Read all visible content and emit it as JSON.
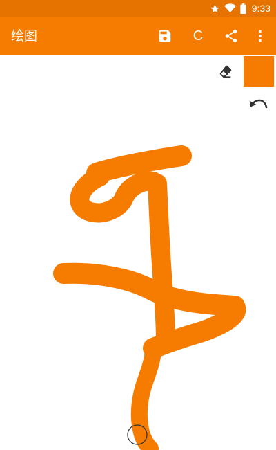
{
  "status_bar": {
    "time": "9:33",
    "icons": [
      "star-icon",
      "wifi-icon",
      "battery-icon"
    ]
  },
  "app_bar": {
    "title": "绘图",
    "clear_label": "C",
    "actions": [
      "save-icon",
      "clear-button",
      "share-icon",
      "more-vert-icon"
    ]
  },
  "tools": {
    "eraser_icon": "eraser-icon",
    "undo_icon": "undo-icon"
  },
  "colors": {
    "status_bar": "#E67300",
    "app_bar": "#F57C00",
    "brush": "#F57C00",
    "canvas": "#ffffff"
  }
}
